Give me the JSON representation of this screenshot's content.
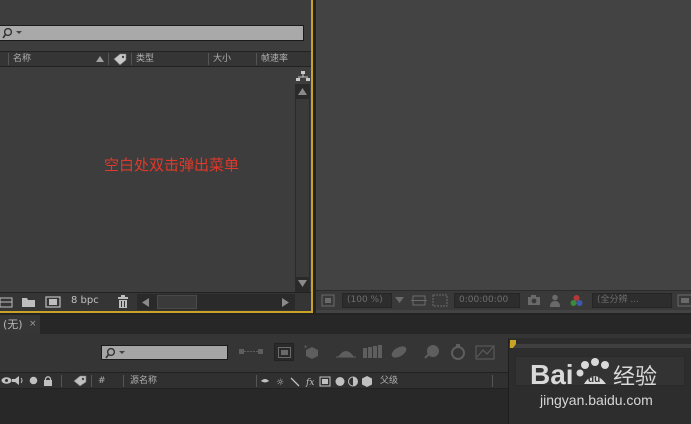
{
  "project_panel": {
    "columns": {
      "name": "名称",
      "type": "类型",
      "size": "大小",
      "frame_rate": "帧速率"
    },
    "hint_text": "空白处双击弹出菜单",
    "footer": {
      "bpc": "8 bpc"
    }
  },
  "comp_viewer": {
    "toolbar": {
      "zoom": "(100 %)",
      "timecode": "0:00:00:00",
      "resolution": "(全分辨 ..."
    }
  },
  "timeline": {
    "tab_label": "(无)",
    "columns": {
      "number": "#",
      "source_name": "源名称",
      "parent": "父级"
    }
  },
  "watermark": {
    "brand": "Baidu经验",
    "url": "jingyan.baidu.com"
  },
  "colors": {
    "panel_bg": "#3d3d3d",
    "viewer_bg": "#434343",
    "active_border": "#c9a227",
    "hint_text": "#e0392b"
  },
  "icons": [
    "search-icon",
    "label-tag-icon",
    "flowchart-icon",
    "interpret-footage-icon",
    "folder-icon",
    "new-composition-icon",
    "trash-icon",
    "camera-icon",
    "person-icon",
    "color-channels-icon",
    "eye-icon",
    "speaker-icon",
    "solo-icon",
    "lock-icon",
    "comp-marker-icon",
    "draft-3d-icon",
    "motion-blur-icon",
    "graph-editor-icon"
  ]
}
